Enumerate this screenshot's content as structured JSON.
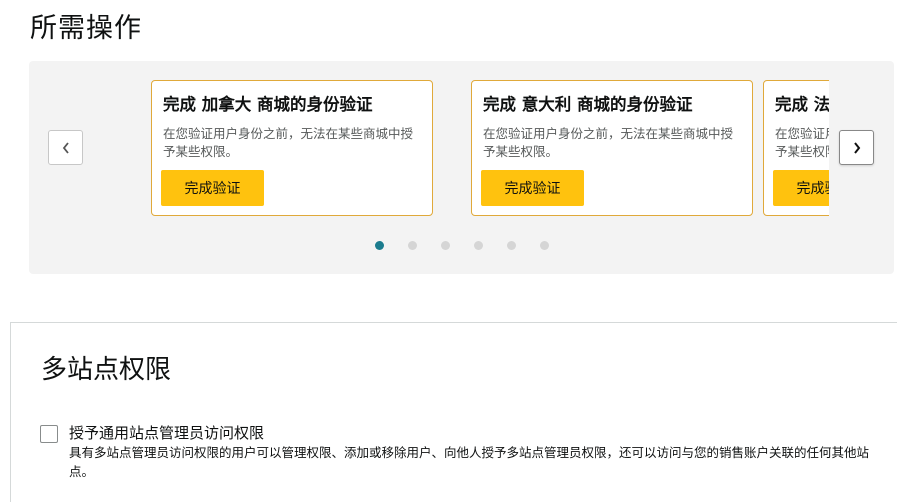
{
  "required_actions": {
    "title": "所需操作",
    "prev_icon": "chevron-left-icon",
    "next_icon": "chevron-right-icon",
    "cards": [
      {
        "title": "完成 加拿大 商城的身份验证",
        "description": "在您验证用户身份之前，无法在某些商城中授予某些权限。",
        "button_label": "完成验证"
      },
      {
        "title": "完成 意大利 商城的身份验证",
        "description": "在您验证用户身份之前，无法在某些商城中授予某些权限。",
        "button_label": "完成验证"
      },
      {
        "title": "完成 法",
        "description": "在您验证用户身份之前，无法在某些商城中授予某些权限。",
        "button_label": "完成验证"
      }
    ],
    "pagination": {
      "total_pages": 6,
      "active_page": 1
    },
    "colors": {
      "active_dot": "#1b7c8e",
      "button": "#ffc20e",
      "card_border": "#e0a93a"
    }
  },
  "multi_site": {
    "title": "多站点权限",
    "option": {
      "label": "授予通用站点管理员访问权限",
      "description": "具有多站点管理员访问权限的用户可以管理权限、添加或移除用户、向他人授予多站点管理员权限，还可以访问与您的销售账户关联的任何其他站点。",
      "checked": false
    }
  }
}
